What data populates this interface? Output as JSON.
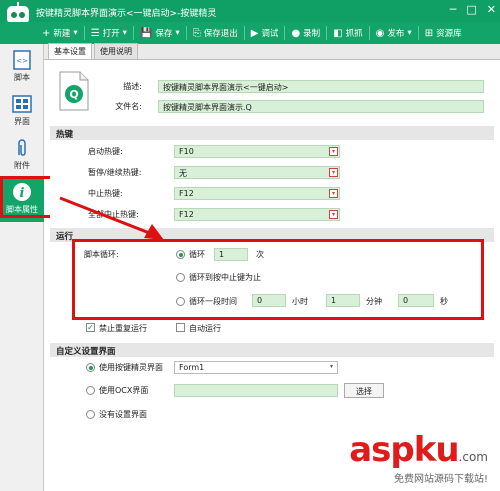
{
  "window": {
    "title": "按键精灵脚本界面演示<一键启动>-按键精灵",
    "controls": [
      "─",
      "□",
      "✕"
    ]
  },
  "toolbar": {
    "items": [
      {
        "icon": "+",
        "label": "新建",
        "has_dropdown": true
      },
      {
        "icon": "☰",
        "label": "打开",
        "has_dropdown": true
      },
      {
        "icon": "💾",
        "label": "保存",
        "has_dropdown": true
      },
      {
        "icon": "⎘",
        "label": "保存退出",
        "has_dropdown": false
      },
      {
        "icon": "▶",
        "label": "调试",
        "has_dropdown": false
      },
      {
        "icon": "●",
        "label": "录制",
        "has_dropdown": false
      },
      {
        "icon": "◧",
        "label": "抓抓",
        "has_dropdown": false
      },
      {
        "icon": "◉",
        "label": "发布",
        "has_dropdown": true
      },
      {
        "icon": "⊞",
        "label": "资源库",
        "has_dropdown": false
      }
    ]
  },
  "sidebar": {
    "items": [
      {
        "label": "脚本",
        "icon": "script-icon"
      },
      {
        "label": "界面",
        "icon": "grid-icon"
      },
      {
        "label": "附件",
        "icon": "paperclip-icon"
      },
      {
        "label": "脚本属性",
        "icon": "info-icon",
        "active": true
      }
    ]
  },
  "tabs": [
    {
      "label": "基本设置",
      "active": true
    },
    {
      "label": "使用说明",
      "active": false
    }
  ],
  "basic": {
    "desc_label": "描述:",
    "desc_value": "按键精灵脚本界面演示<一键启动>",
    "filename_label": "文件名:",
    "filename_value": "按键精灵脚本界面演示.Q",
    "file_icon_letter": "Q"
  },
  "hotkeys": {
    "section_title": "热键",
    "rows": [
      {
        "label": "启动热键:",
        "value": "F10"
      },
      {
        "label": "暂停/继续热键:",
        "value": "无"
      },
      {
        "label": "中止热键:",
        "value": "F12"
      },
      {
        "label": "全部中止热键:",
        "value": "F12"
      }
    ]
  },
  "run": {
    "section_title": "运行",
    "loop_label": "脚本循环:",
    "option1_label": "循环",
    "option1_count": "1",
    "option1_unit": "次",
    "option2_label": "循环到按中止键为止",
    "option3_label": "循环一段时间",
    "hours_value": "0",
    "hours_unit": "小时",
    "minutes_value": "1",
    "minutes_unit": "分钟",
    "seconds_value": "0",
    "seconds_unit": "秒",
    "no_rerun_label": "禁止重复运行",
    "no_rerun_checked": true,
    "auto_run_label": "自动运行",
    "auto_run_checked": false
  },
  "custom_ui": {
    "section_title": "自定义设置界面",
    "opt1_label": "使用按键精灵界面",
    "opt1_select": "Form1",
    "opt2_label": "使用OCX界面",
    "choose_button": "选择",
    "opt3_label": "没有设置界面"
  },
  "watermark": {
    "text": "aspku",
    "suffix": ".com",
    "sub": "免费网站源码下载站!"
  },
  "colors": {
    "titlebar": "#10a065",
    "field_bg": "#d8f0d8",
    "highlight_red": "#e01010"
  }
}
